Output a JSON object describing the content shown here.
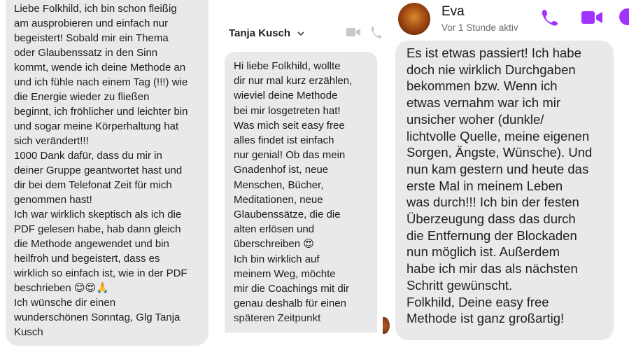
{
  "accent_color": "#a033ff",
  "panel1": {
    "message": "Liebe Folkhild, ich bin schon fleißig\nam ausprobieren und einfach nur\nbegeistert! Sobald mir ein Thema\noder Glaubenssatz in den Sinn\nkommt, wende ich deine Methode an\nund ich fühle nach einem Tag (!!!) wie\ndie Energie wieder zu fließen\nbeginnt, ich fröhlicher und leichter bin\nund sogar meine Körperhaltung hat\nsich verändert!!!\n1000 Dank dafür, dass du mir in\ndeiner Gruppe geantwortet hast und\ndir bei dem Telefonat Zeit für mich\ngenommen hast!\nIch war wirklich skeptisch als ich die\nPDF gelesen habe, hab dann gleich\ndie Methode angewendet und bin\nheilfroh und begeistert, dass es\nwirklich so einfach ist, wie in der PDF\nbeschrieben 😊😍🙏\nIch wünsche dir einen\nwunderschönen Sonntag, Glg Tanja\nKusch"
  },
  "panel2": {
    "contact_name": "Tanja Kusch",
    "icons": {
      "dropdown": "chevron-down-icon",
      "video": "video-camera-icon",
      "call": "phone-icon"
    },
    "message": "Hi liebe Folkhild, wollte\ndir nur mal kurz erzählen,\nwieviel deine Methode\nbei mir losgetreten hat!\nWas mich seit easy free\nalles findet ist einfach\nnur genial! Ob das mein\nGnadenhof ist, neue\nMenschen, Bücher,\nMeditationen, neue\nGlaubenssätze, die die\nalten erlösen und\nüberschreiben 😍\nIch bin wirklich auf\nmeinem Weg, möchte\nmir die Coachings mit dir\ngenau deshalb für einen\nspäteren Zeitpunkt"
  },
  "panel3": {
    "contact_name": "Eva",
    "status": "Vor 1 Stunde aktiv",
    "icons": {
      "call": "phone-icon",
      "video": "video-camera-icon",
      "info": "info-icon"
    },
    "message": "Es ist etwas passiert! Ich habe\ndoch nie wirklich Durchgaben\nbekommen bzw. Wenn ich\netwas vernahm war ich mir\nunsicher woher (dunkle/\nlichtvolle Quelle, meine eigenen\nSorgen, Ängste, Wünsche). Und\nnun kam gestern und heute das\nerste Mal in meinem Leben\nwas durch!!! Ich bin der festen\nÜberzeugung dass das durch\ndie Entfernung der Blockaden\nnun möglich ist. Außerdem\nhabe ich mir das als nächsten\nSchritt gewünscht.\nFolkhild, Deine easy free\nMethode ist ganz großartig!"
  }
}
